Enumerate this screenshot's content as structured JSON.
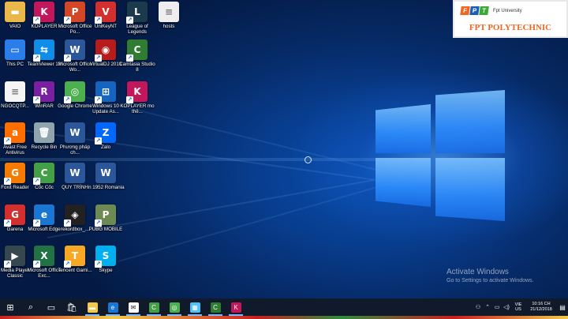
{
  "desktop_icons": [
    {
      "label": "VAIO",
      "icon": "folder-icon",
      "color": "#e8b84a",
      "glyph": "▬"
    },
    {
      "label": "KOPLAYER",
      "icon": "koplayer-icon",
      "color": "#c2185b",
      "glyph": "K"
    },
    {
      "label": "Microsoft Office Po...",
      "icon": "powerpoint-icon",
      "color": "#d24726",
      "glyph": "P"
    },
    {
      "label": "UniKeyNT",
      "icon": "unikey-icon",
      "color": "#d32f2f",
      "glyph": "V"
    },
    {
      "label": "League of Legends",
      "icon": "league-icon",
      "color": "#1b3a4b",
      "glyph": "L"
    },
    {
      "label": "hosts",
      "icon": "file-icon",
      "color": "#eeeeee",
      "glyph": "≡"
    },
    {
      "label": "This PC",
      "icon": "computer-icon",
      "color": "#2b7de9",
      "glyph": "▭"
    },
    {
      "label": "TeamViewer 13",
      "icon": "teamviewer-icon",
      "color": "#0e8ee9",
      "glyph": "⇆"
    },
    {
      "label": "Microsoft Office Wo...",
      "icon": "word-icon",
      "color": "#2b579a",
      "glyph": "W"
    },
    {
      "label": "VirtualDJ 2018",
      "icon": "virtualdj-icon",
      "color": "#b71c1c",
      "glyph": "◉"
    },
    {
      "label": "Camtasia Studio 8",
      "icon": "camtasia-icon",
      "color": "#2e7d32",
      "glyph": "C"
    },
    {
      "label": "NGOCQTP...",
      "icon": "document-icon",
      "color": "#f5f5f5",
      "glyph": "≡"
    },
    {
      "label": "WinRAR",
      "icon": "winrar-icon",
      "color": "#7b1fa2",
      "glyph": "R"
    },
    {
      "label": "Google Chrome",
      "icon": "chrome-icon",
      "color": "#4caf50",
      "glyph": "◎"
    },
    {
      "label": "Windows 10 Update As...",
      "icon": "windows-update-icon",
      "color": "#1565c0",
      "glyph": "⊞"
    },
    {
      "label": "KOPLAYER mo thê...",
      "icon": "koplayer-icon",
      "color": "#c2185b",
      "glyph": "K"
    },
    {
      "label": "Avast Free Antivirus",
      "icon": "avast-icon",
      "color": "#ff6f00",
      "glyph": "a"
    },
    {
      "label": "Recycle Bin",
      "icon": "recycle-bin-icon",
      "color": "#90a4ae",
      "glyph": "🗑"
    },
    {
      "label": "Phương pháp ch...",
      "icon": "word-doc-icon",
      "color": "#2b579a",
      "glyph": "W"
    },
    {
      "label": "Zalo",
      "icon": "zalo-icon",
      "color": "#0068ff",
      "glyph": "Z"
    },
    {
      "label": "Foxit Reader",
      "icon": "foxit-icon",
      "color": "#f57c00",
      "glyph": "G"
    },
    {
      "label": "Cốc Cốc",
      "icon": "coccoc-icon",
      "color": "#43a047",
      "glyph": "C"
    },
    {
      "label": "QUY TRÌNH",
      "icon": "word-doc-icon",
      "color": "#2b579a",
      "glyph": "W"
    },
    {
      "label": "In 1952 Romania",
      "icon": "word-doc-icon",
      "color": "#2b579a",
      "glyph": "W"
    },
    {
      "label": "Garena",
      "icon": "garena-icon",
      "color": "#d32f2f",
      "glyph": "G"
    },
    {
      "label": "Microsoft Edge",
      "icon": "edge-icon",
      "color": "#1976d2",
      "glyph": "e"
    },
    {
      "label": "rekordbox_...",
      "icon": "rekordbox-icon",
      "color": "#212121",
      "glyph": "◈"
    },
    {
      "label": "PUBG MOBILE",
      "icon": "pubg-icon",
      "color": "#6d8a52",
      "glyph": "P"
    },
    {
      "label": "Media Player Classic",
      "icon": "media-player-icon",
      "color": "#37474f",
      "glyph": "▶"
    },
    {
      "label": "Microsoft Office Exc...",
      "icon": "excel-icon",
      "color": "#217346",
      "glyph": "X"
    },
    {
      "label": "Tencent Gami...",
      "icon": "tencent-icon",
      "color": "#f9a825",
      "glyph": "T"
    },
    {
      "label": "Skype",
      "icon": "skype-icon",
      "color": "#00aff0",
      "glyph": "S"
    }
  ],
  "fpt_badge": {
    "letters": [
      "F",
      "P",
      "T"
    ],
    "letter_colors": [
      "#f26522",
      "#1a5fb4",
      "#3aa935"
    ],
    "university": "Fpt University",
    "title": "FPT POLYTECHNIC"
  },
  "watermark": {
    "title": "Activate Windows",
    "subtitle": "Go to Settings to activate Windows."
  },
  "taskbar": {
    "apps": [
      {
        "name": "start",
        "icon": "windows-start-icon",
        "glyph": "⊞",
        "color": "#ffffff"
      },
      {
        "name": "search",
        "icon": "search-icon",
        "glyph": "⌕",
        "color": "#ffffff"
      },
      {
        "name": "task-view",
        "icon": "task-view-icon",
        "glyph": "▭",
        "color": "#ffffff"
      },
      {
        "name": "store",
        "icon": "store-icon",
        "glyph": "🛍",
        "color": "#ffffff"
      },
      {
        "name": "file-explorer",
        "icon": "folder-icon",
        "glyph": "▬",
        "color": "#f2c94c"
      },
      {
        "name": "edge",
        "icon": "edge-icon",
        "glyph": "e",
        "color": "#1976d2"
      },
      {
        "name": "mail",
        "icon": "mail-icon",
        "glyph": "✉",
        "color": "#ffffff"
      },
      {
        "name": "coccoc",
        "icon": "coccoc-icon",
        "glyph": "C",
        "color": "#43a047"
      },
      {
        "name": "chrome",
        "icon": "chrome-icon",
        "glyph": "◎",
        "color": "#4caf50"
      },
      {
        "name": "photos",
        "icon": "photos-icon",
        "glyph": "▦",
        "color": "#4fc3f7"
      },
      {
        "name": "camtasia",
        "icon": "camtasia-icon",
        "glyph": "C",
        "color": "#2e7d32"
      },
      {
        "name": "koplayer",
        "icon": "koplayer-icon",
        "glyph": "K",
        "color": "#c2185b"
      }
    ],
    "tray": {
      "language": "VIE",
      "region": "US",
      "time": "10:16 CH",
      "date": "21/12/2018"
    }
  }
}
